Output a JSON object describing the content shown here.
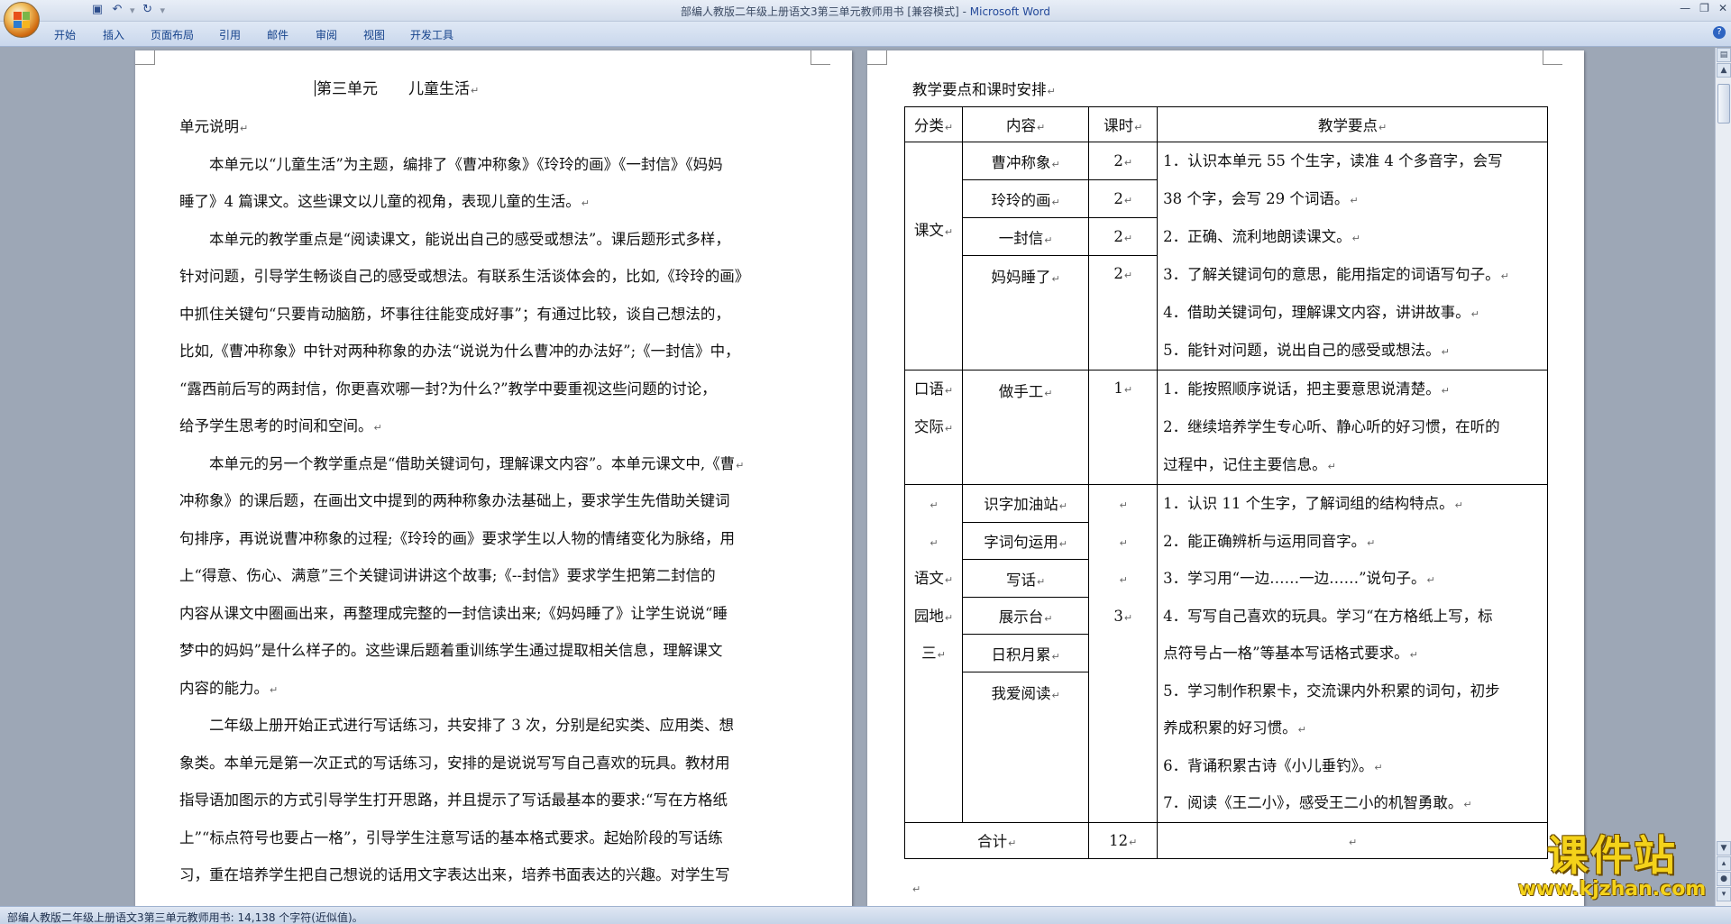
{
  "window": {
    "title_doc": "部编人教版二年级上册语文3第三单元教师用书 [兼容模式]",
    "title_sep": " - ",
    "title_app": "Microsoft Word"
  },
  "qat": {
    "save_icon": "save-icon",
    "undo_icon": "undo-icon",
    "redo_icon": "redo-icon"
  },
  "ribbon_tabs": [
    "开始",
    "插入",
    "页面布局",
    "引用",
    "邮件",
    "审阅",
    "视图",
    "开发工具"
  ],
  "page_left": {
    "heading": "第三单元　　儿童生活",
    "section": "单元说明",
    "lines": [
      "　　本单元以“儿童生活”为主题，编排了《曹冲称象》《玲玲的画》《一封信》《妈妈",
      "睡了》4 篇课文。这些课文以儿童的视角，表现儿童的生活。",
      "　　本单元的教学重点是“阅读课文，能说出自己的感受或想法”。课后题形式多样，",
      "针对问题，引导学生畅谈自己的感受或想法。有联系生活谈体会的，比如,《玲玲的画》",
      "中抓住关键句“只要肯动脑筋，坏事往往能变成好事”；有通过比较，谈自己想法的，",
      "比如,《曹冲称象》中针对两种称象的办法“说说为什么曹冲的办法好”;《一封信》中，",
      "“露西前后写的两封信，你更喜欢哪一封?为什么?”教学中要重视这些问题的讨论，",
      "给予学生思考的时间和空间。",
      "　　本单元的另一个教学重点是“借助关键词句，理解课文内容”。本单元课文中,《曹",
      "冲称象》的课后题，在画出文中提到的两种称象办法基础上，要求学生先借助关键词",
      "句排序，再说说曹冲称象的过程;《玲玲的画》要求学生以人物的情绪变化为脉络，用",
      "上“得意、伤心、满意”三个关键词讲讲这个故事;《--封信》要求学生把第二封信的",
      "内容从课文中圈画出来，再整理成完整的一封信读出来;《妈妈睡了》让学生说说“睡",
      "梦中的妈妈”是什么样子的。这些课后题着重训练学生通过提取相关信息，理解课文",
      "内容的能力。",
      "　　二年级上册开始正式进行写话练习，共安排了 3 次，分别是纪实类、应用类、想",
      "象类。本单元是第一次正式的写话练习，安排的是说说写写自己喜欢的玩具。教材用",
      "指导语加图示的方式引导学生打开思路，并且提示了写话最基本的要求:“写在方格纸",
      "上”“标点符号也要占一格”，引导学生注意写话的基本格式要求。起始阶段的写话练",
      "习，重在培养学生把自己想说的话用文字表达出来，培养书面表达的兴趣。对学生写"
    ]
  },
  "page_right": {
    "heading": "教学要点和课时安排",
    "table": {
      "headers": [
        "分类",
        "内容",
        "课时",
        "教学要点"
      ],
      "groups": [
        {
          "category": [
            "课文"
          ],
          "items": [
            {
              "name": "曹冲称象",
              "hours": "2"
            },
            {
              "name": "玲玲的画",
              "hours": "2"
            },
            {
              "name": "一封信",
              "hours": "2"
            },
            {
              "name": "妈妈睡了",
              "hours": "2"
            }
          ],
          "points": [
            "1．认识本单元 55 个生字，读准 4 个多音字，会写",
            "38 个字，会写 29 个词语。",
            "2．正确、流利地朗读课文。",
            "3．了解关键词句的意思，能用指定的词语写句子。",
            "4．借助关键词句，理解课文内容，讲讲故事。",
            "5．能针对问题，说出自己的感受或想法。"
          ]
        },
        {
          "category": [
            "口语",
            "交际"
          ],
          "items": [
            {
              "name": "做手工",
              "hours": "1"
            }
          ],
          "points": [
            "1．能按照顺序说话，把主要意思说清楚。",
            "2．继续培养学生专心听、静心听的好习惯，在听的",
            "过程中，记住主要信息。"
          ]
        },
        {
          "category": [
            "语文",
            "园地",
            "三"
          ],
          "items": [
            {
              "name": "识字加油站"
            },
            {
              "name": "字词句运用"
            },
            {
              "name": "写话"
            },
            {
              "name": "展示台"
            },
            {
              "name": "日积月累"
            },
            {
              "name": "我爱阅读"
            }
          ],
          "hours": "3",
          "points": [
            "1．认识 11 个生字，了解词组的结构特点。",
            "2．能正确辨析与运用同音字。",
            "3．学习用“一边……一边……”说句子。",
            "4．写写自己喜欢的玩具。学习“在方格纸上写，标",
            "点符号占一格”等基本写话格式要求。",
            "5．学习制作积累卡，交流课内外积累的词句，初步",
            "养成积累的好习惯。",
            "6．背诵积累古诗《小儿垂钓》。",
            "7．阅读《王二小》，感受王二小的机智勇敢。"
          ]
        }
      ],
      "total_label": "合计",
      "total_hours": "12"
    }
  },
  "statusbar": {
    "text": "部编人教版二年级上册语文3第三单元教师用书: 14,138 个字符(近似值)。"
  },
  "watermark": {
    "title": "课件站",
    "url": "www.kjzhan.com"
  },
  "colors": {
    "ribbon_text": "#15428b",
    "app_title": "#254a9a",
    "watermark": "#f4d21a",
    "doc_bg": "#9da7b6"
  }
}
